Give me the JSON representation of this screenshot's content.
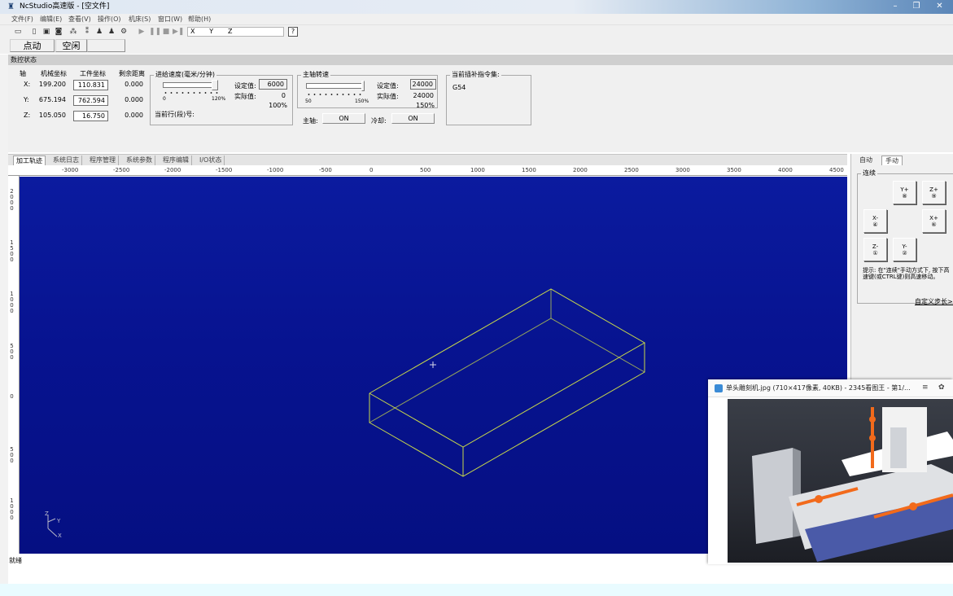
{
  "window": {
    "title": "NcStudio高速版 - [空文件]",
    "min": "–",
    "max": "❐",
    "close": "✕"
  },
  "menu": [
    "文件(F)",
    "编辑(E)",
    "查看(V)",
    "操作(O)",
    "机床(S)",
    "窗口(W)",
    "帮助(H)"
  ],
  "toolbar": {
    "axis_field": "X       Y       Z",
    "help": "?"
  },
  "mode": {
    "jog": "点动",
    "idle": "空闲"
  },
  "status": {
    "header": "数控状态",
    "col_axis": "轴",
    "col_machine": "机械坐标",
    "col_work": "工件坐标",
    "col_remaining": "剩余距离",
    "axes": [
      {
        "name": "X:",
        "machine": "199.200",
        "work": "110.831",
        "remaining": "0.000"
      },
      {
        "name": "Y:",
        "machine": "675.194",
        "work": "762.594",
        "remaining": "0.000"
      },
      {
        "name": "Z:",
        "machine": "105.050",
        "work": "16.750",
        "remaining": "0.000"
      }
    ],
    "feed": {
      "title": "进给速度(毫米/分钟)",
      "set_label": "设定值:",
      "set_value": "6000",
      "actual_label": "实际值:",
      "actual_value": "0",
      "percent": "100%",
      "min": "0",
      "max": "120%",
      "line_label": "当前行(段)号:"
    },
    "spindle": {
      "title": "主轴转速",
      "set_label": "设定值:",
      "set_value": "24000",
      "actual_label": "实际值:",
      "actual_value": "24000",
      "percent": "150%",
      "min": "50",
      "max": "150%"
    },
    "spindle_on_label": "主轴:",
    "spindle_on": "ON",
    "coolant_label": "冷却:",
    "coolant_on": "ON",
    "gcode": {
      "title": "当前插补指令集:",
      "value": "G54"
    }
  },
  "tabs": [
    "加工轨迹",
    "系统日志",
    "程序管理",
    "系统参数",
    "程序编辑",
    "I/O状态"
  ],
  "ruler": {
    "x": [
      "-3000",
      "-2500",
      "-2000",
      "-1500",
      "-1000",
      "-500",
      "0",
      "500",
      "1000",
      "1500",
      "2000",
      "2500",
      "3000",
      "3500",
      "4000",
      "4500"
    ],
    "y": [
      "2000",
      "1500",
      "1000",
      "500",
      "0",
      "500",
      "1000"
    ]
  },
  "canvas": {
    "axis_y": "Y",
    "axis_x": "X",
    "axis_z": "Z",
    "box_color": "#c8d84a",
    "bg_color": "#0a1896"
  },
  "status_bar": "就绪",
  "manual": {
    "tab_auto": "自动",
    "tab_manual": "手动",
    "mode": "连续",
    "buttons": {
      "y_plus": "Y+\n⑧",
      "z_plus": "Z+\n⑨",
      "x_minus": "X-\n④",
      "x_plus": "X+\n⑥",
      "z_minus": "Z-\n①",
      "y_minus": "Y-\n②"
    },
    "hint": "提示: 在\"连续\"手动方式下, 按下高速键(或CTRL键)则高速移动。",
    "custom_step": "自定义步长>>"
  },
  "viewer": {
    "title": "单头雕刻机.jpg (710×417像素, 40KB) - 2345看图王 - 第1/...",
    "accent": "#f26a1b"
  }
}
